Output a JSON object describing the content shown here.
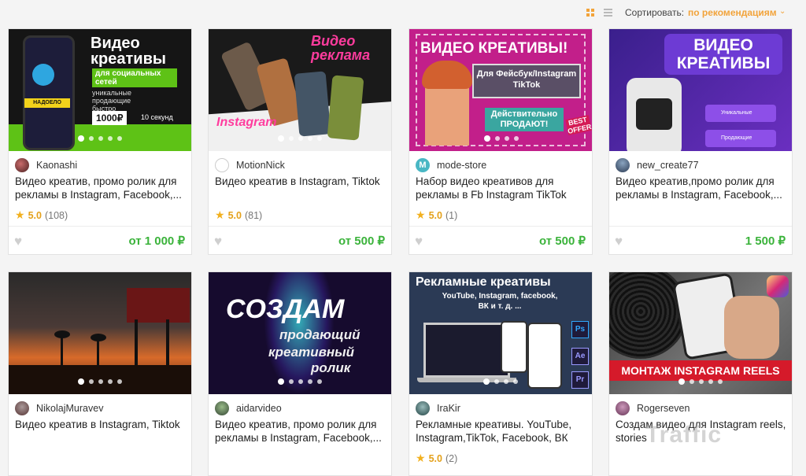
{
  "sort": {
    "label": "Сортировать:",
    "value": "по рекомендациям"
  },
  "colors": {
    "accent": "#f2a33a",
    "price": "#3bb33b",
    "star": "#f2b01e"
  },
  "cards": [
    {
      "seller": "Kaonashi",
      "title": "Видео креатив, промо ролик для рекламы в Instagram, Facebook,...",
      "rating": "5.0",
      "reviews": "(108)",
      "price": "от 1 000 ₽",
      "thumb": {
        "headline": "Видео креативы",
        "sub": "для социальных сетей",
        "desc": "уникальные продающие быстро",
        "phone_badge": "НАДОЕЛО",
        "price_tag": "1000₽",
        "time": "10 секунд"
      }
    },
    {
      "seller": "MotionNick",
      "title": "Видео креатив в Instagram, Tiktok",
      "rating": "5.0",
      "reviews": "(81)",
      "price": "от 500 ₽",
      "thumb": {
        "headline": "Видео реклама",
        "sub": "Instagram"
      }
    },
    {
      "seller": "mode-store",
      "title": "Набор видео креативов для рекламы в Fb Instagram TikTok",
      "rating": "5.0",
      "reviews": "(1)",
      "price": "от 500 ₽",
      "thumb": {
        "headline": "ВИДЕО КРЕАТИВЫ!",
        "box": "Для Фейсбук/Instagram TikTok",
        "banner": "Действительно ПРОДАЮТ!",
        "corner": "BEST OFFER"
      }
    },
    {
      "seller": "new_create77",
      "title": "Видео креатив,промо ролик для рекламы в Instagram, Facebook,...",
      "rating": "",
      "reviews": "",
      "price": "1 500 ₽",
      "thumb": {
        "headline": "ВИДЕО КРЕАТИВЫ",
        "item1": "Уникальные",
        "item2": "Продающие"
      }
    },
    {
      "seller": "NikolajMuravev",
      "title": "Видео креатив в Instagram, Tiktok",
      "rating": "",
      "reviews": "",
      "price": "",
      "thumb": {}
    },
    {
      "seller": "aidarvideo",
      "title": "Видео креатив, промо ролик для рекламы в Instagram, Facebook,...",
      "rating": "",
      "reviews": "",
      "price": "",
      "thumb": {
        "headline": "СОЗДАМ",
        "l2": "продающий",
        "l3": "креативный",
        "l4": "ролик"
      }
    },
    {
      "seller": "IraKir",
      "title": "Рекламные креативы. YouTube, Instagram,TikTok, Facebook, ВК",
      "rating": "5.0",
      "reviews": "(2)",
      "price": "",
      "thumb": {
        "headline": "Рекламные креативы",
        "sub": "YouTube, Instagram, facebook, ВК и т. д. ..."
      }
    },
    {
      "seller": "Rogerseven",
      "title": "Создам видео для Instagram reels, stories",
      "rating": "",
      "reviews": "",
      "price": "",
      "thumb": {
        "banner": "МОНТАЖ INSTAGRAM REELS"
      }
    }
  ],
  "watermark": "Traffic"
}
